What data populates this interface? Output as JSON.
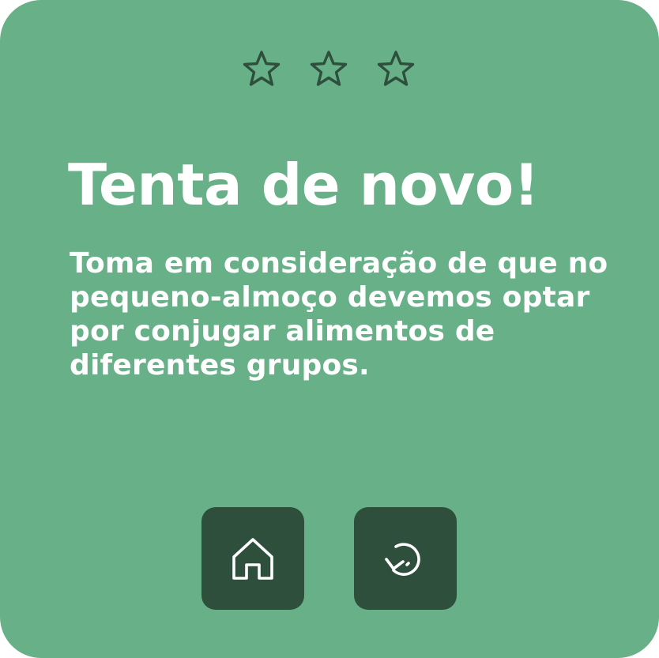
{
  "result": {
    "rating": {
      "earned": 0,
      "total": 3
    },
    "title": "Tenta de novo!",
    "message": "Toma em consideração de que no pequeno-almoço devemos optar por conjugar alimentos de diferentes grupos."
  },
  "actions": {
    "home_icon": "home-icon",
    "retry_icon": "retry-icon"
  },
  "colors": {
    "card_background": "#67b088",
    "button_background": "#2d4f3c",
    "star_outline": "#2d4f3c",
    "text": "#ffffff"
  }
}
